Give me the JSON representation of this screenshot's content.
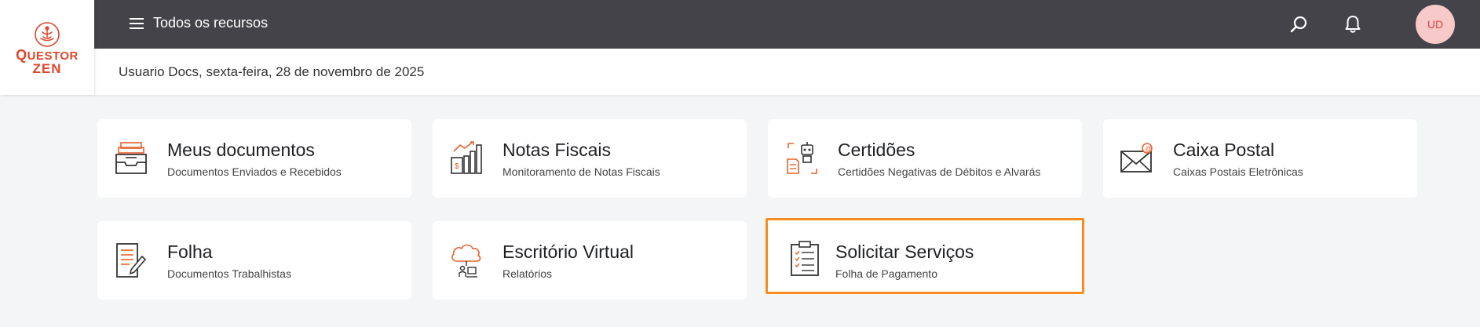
{
  "brand": {
    "logo_line1_initial": "Q",
    "logo_line1_rest": "UESTOR",
    "logo_line2": "ZEN",
    "accent": "#e0452a"
  },
  "header": {
    "title": "Todos os recursos",
    "menu_icon": "hamburger-icon",
    "search_icon": "search-icon",
    "notification_icon": "bell-icon",
    "avatar_initials": "UD",
    "background": "#444349"
  },
  "subheader": {
    "greeting": "Usuario Docs, sexta-feira, 28 de novembro de 2025"
  },
  "cards": [
    {
      "title": "Meus documentos",
      "subtitle": "Documentos Enviados e Recebidos",
      "icon": "document-tray-icon",
      "selected": false
    },
    {
      "title": "Notas Fiscais",
      "subtitle": "Monitoramento de Notas Fiscais",
      "icon": "invoice-chart-icon",
      "selected": false
    },
    {
      "title": "Certidões",
      "subtitle": "Certidões Negativas de Débitos e Alvarás",
      "icon": "robot-certificate-icon",
      "selected": false
    },
    {
      "title": "Caixa Postal",
      "subtitle": "Caixas Postais Eletrônicas",
      "icon": "mail-envelope-icon",
      "selected": false
    },
    {
      "title": "Folha",
      "subtitle": "Documentos Trabalhistas",
      "icon": "payroll-sheet-icon",
      "selected": false
    },
    {
      "title": "Escritório Virtual",
      "subtitle": "Relatórios",
      "icon": "cloud-office-icon",
      "selected": false
    },
    {
      "title": "Solicitar Serviços",
      "subtitle": "Folha de Pagamento",
      "icon": "clipboard-checklist-icon",
      "selected": true
    }
  ],
  "colors": {
    "selected_border": "#f98c1c",
    "icon_accent": "#e8622f"
  }
}
